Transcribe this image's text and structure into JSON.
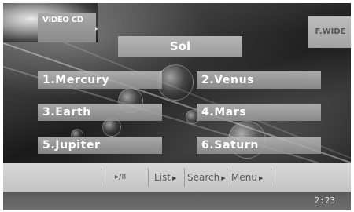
{
  "source": {
    "label": "VIDEO CD",
    "arrow": "▸"
  },
  "title": "Sol",
  "aspect_button": "F.WIDE",
  "tracks": [
    {
      "label": "1.Mercury"
    },
    {
      "label": "2.Venus"
    },
    {
      "label": "3.Earth"
    },
    {
      "label": "4.Mars"
    },
    {
      "label": "5.Jupiter"
    },
    {
      "label": "6.Saturn"
    }
  ],
  "controls": {
    "play_pause": "▸/II",
    "list": "List",
    "search": "Search",
    "menu": "Menu",
    "arrow": "▶"
  },
  "status": {
    "clock": "2:23"
  }
}
